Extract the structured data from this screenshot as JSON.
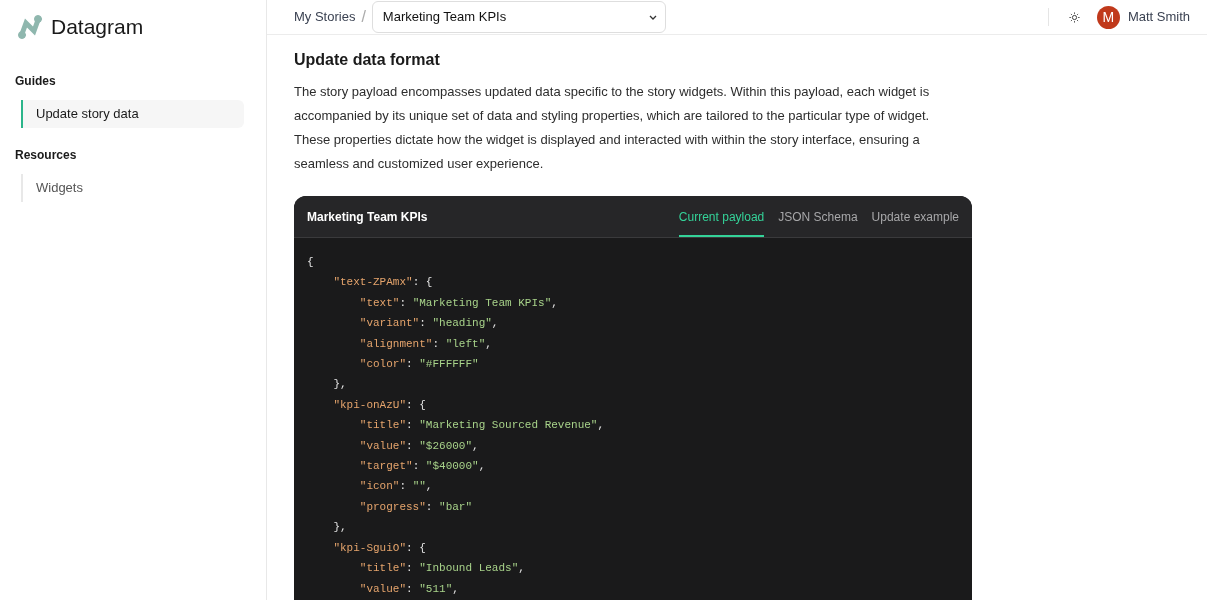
{
  "app": {
    "name": "Datagram"
  },
  "sidebar": {
    "sections": [
      {
        "title": "Guides",
        "items": [
          {
            "label": "Update story data",
            "selected": true
          }
        ]
      },
      {
        "title": "Resources",
        "items": [
          {
            "label": "Widgets",
            "selected": false
          }
        ]
      }
    ]
  },
  "header": {
    "breadcrumb": "My Stories",
    "separator": "/",
    "story_select": "Marketing Team KPIs",
    "user": {
      "initial": "M",
      "name": "Matt Smith"
    }
  },
  "content": {
    "heading": "Update data format",
    "paragraph": "The story payload encompasses updated data specific to the story widgets. Within this payload, each widget is accompanied by its unique set of data and styling properties, which are tailored to the particular type of widget. These properties dictate how the widget is displayed and interacted with within the story interface, ensuring a seamless and customized user experience."
  },
  "code_panel": {
    "title": "Marketing Team KPIs",
    "tabs": [
      {
        "label": "Current payload",
        "selected": true
      },
      {
        "label": "JSON Schema",
        "selected": false
      },
      {
        "label": "Update example",
        "selected": false
      }
    ],
    "lines": [
      "{",
      "    \"text-ZPAmx\": {",
      "        \"text\": \"Marketing Team KPIs\",",
      "        \"variant\": \"heading\",",
      "        \"alignment\": \"left\",",
      "        \"color\": \"#FFFFFF\"",
      "    },",
      "    \"kpi-onAzU\": {",
      "        \"title\": \"Marketing Sourced Revenue\",",
      "        \"value\": \"$26000\",",
      "        \"target\": \"$40000\",",
      "        \"icon\": \"\",",
      "        \"progress\": \"bar\"",
      "    },",
      "    \"kpi-SguiO\": {",
      "        \"title\": \"Inbound Leads\",",
      "        \"value\": \"511\","
    ]
  }
}
